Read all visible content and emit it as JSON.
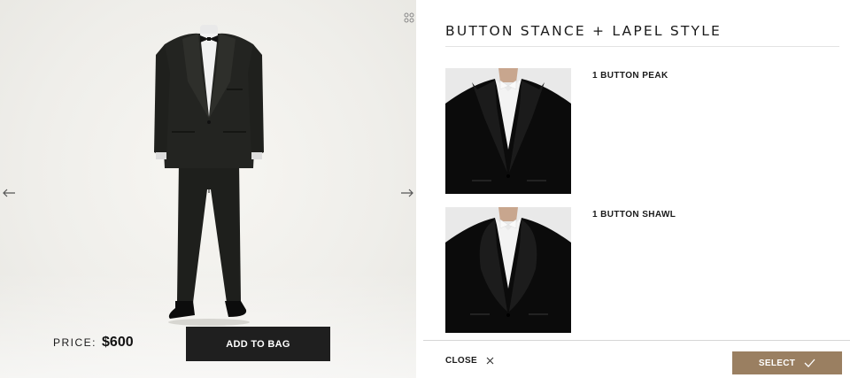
{
  "viewer": {
    "price_label": "PRICE:",
    "price_value": "$600",
    "add_to_bag_label": "ADD TO BAG",
    "prev_icon": "arrow-left-icon",
    "next_icon": "arrow-right-icon",
    "expand_icon": "expand-icon"
  },
  "panel": {
    "title": "BUTTON STANCE + LAPEL STYLE",
    "options": [
      {
        "label": "1 BUTTON PEAK",
        "lapel": "peak"
      },
      {
        "label": "1 BUTTON SHAWL",
        "lapel": "shawl"
      }
    ],
    "close_label": "CLOSE",
    "select_label": "SELECT"
  },
  "colors": {
    "accent": "#9a7f61",
    "button_dark": "#1f1f1f"
  }
}
